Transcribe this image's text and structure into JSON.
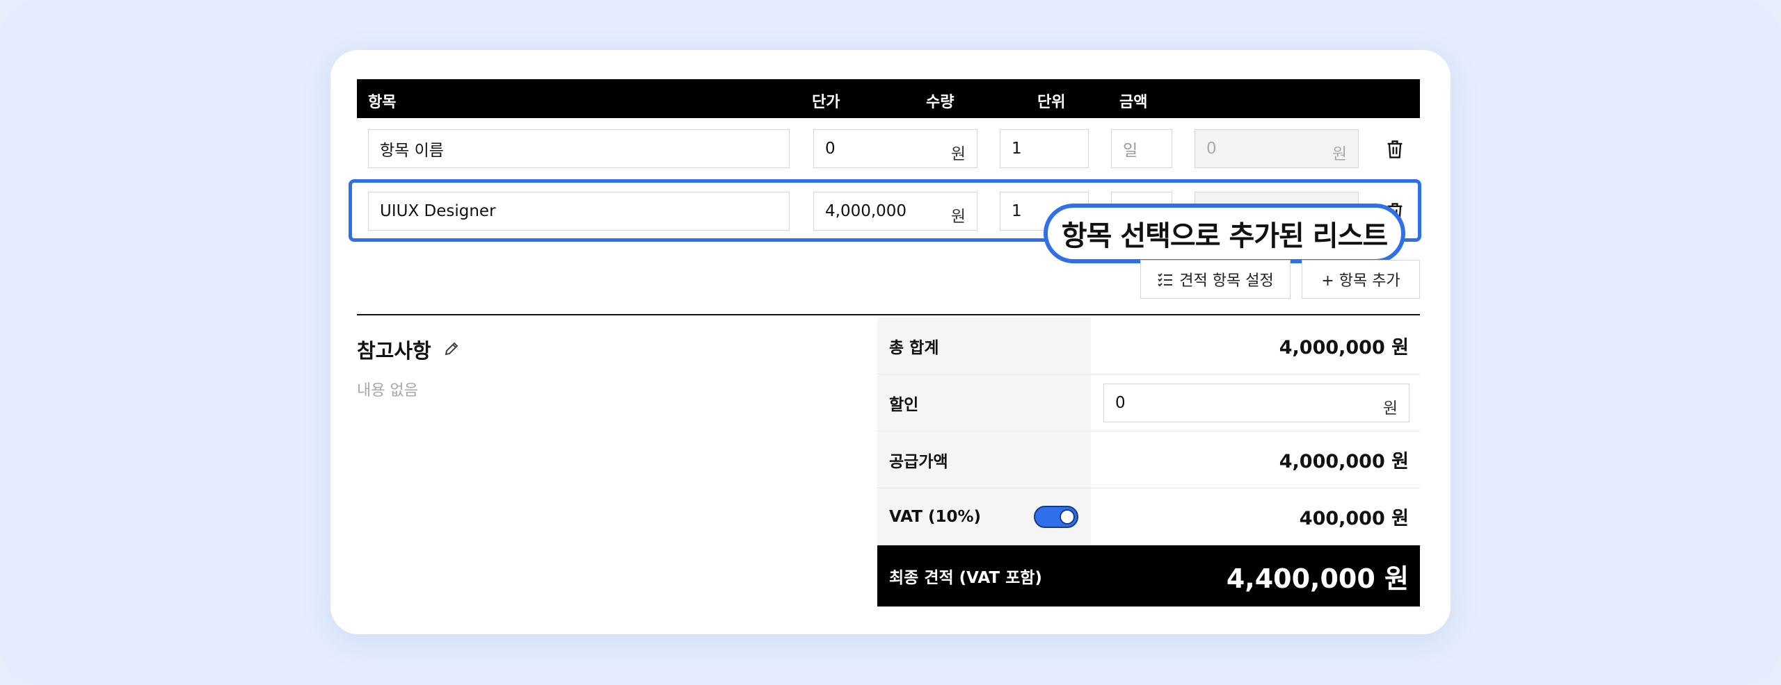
{
  "table": {
    "headers": {
      "item": "항목",
      "unit_price": "단가",
      "qty": "수량",
      "unit": "단위",
      "amount": "금액"
    },
    "rows": [
      {
        "item_placeholder": "항목 이름",
        "price": "0",
        "currency": "원",
        "qty": "1",
        "unit_placeholder": "일",
        "amount": "0",
        "amount_currency": "원"
      },
      {
        "item": "UIUX Designer",
        "price": "4,000,000",
        "currency": "원",
        "qty": "1"
      }
    ]
  },
  "callout": {
    "text": "항목 선택으로 추가된 리스트"
  },
  "buttons": {
    "settings": "견적 항목 설정",
    "add": "+ 항목 추가"
  },
  "notes": {
    "title": "참고사항",
    "empty": "내용 없음"
  },
  "summary": {
    "total_label": "총 합계",
    "total_value": "4,000,000 원",
    "discount_label": "할인",
    "discount_value": "0",
    "discount_unit": "원",
    "supply_label": "공급가액",
    "supply_value": "4,000,000 원",
    "vat_label": "VAT (10%)",
    "vat_value": "400,000 원",
    "vat_enabled": true,
    "final_label": "최종 견적 (VAT 포함)",
    "final_value": "4,400,000 원"
  },
  "colors": {
    "accent": "#2f6fe9",
    "background": "#e4ecfd",
    "header": "#000000"
  }
}
